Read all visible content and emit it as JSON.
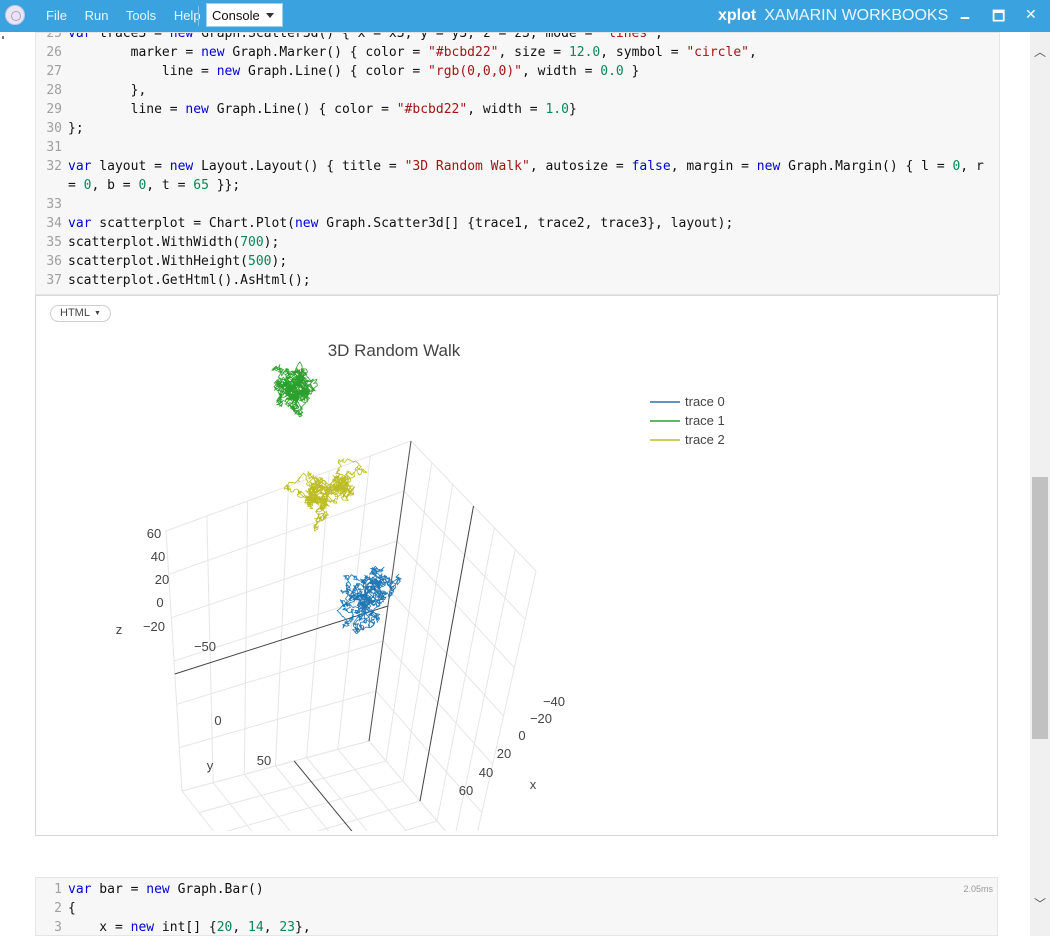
{
  "app": {
    "name": "xplot",
    "window_title": "XAMARIN WORKBOOKS",
    "icon": "workbooks-logo-icon"
  },
  "menu": [
    {
      "label": "File"
    },
    {
      "label": "Run"
    },
    {
      "label": "Tools"
    },
    {
      "label": "Help"
    }
  ],
  "mode_select": {
    "value": "Console"
  },
  "window_controls": {
    "minimize": "🗕",
    "maximize": "🗖",
    "close": "✕"
  },
  "code_cell_1": {
    "lines": [
      {
        "n": "25",
        "tokens": [
          {
            "t": "var",
            "c": "kw"
          },
          {
            "t": " trace3 = "
          },
          {
            "t": "new",
            "c": "kw"
          },
          {
            "t": " Graph.Scatter3d() { x = x3, y = y3, z = z3, mode = "
          },
          {
            "t": "\"lines\"",
            "c": "str"
          },
          {
            "t": ","
          }
        ]
      },
      {
        "n": "26",
        "tokens": [
          {
            "t": "        marker = "
          },
          {
            "t": "new",
            "c": "kw"
          },
          {
            "t": " Graph.Marker() { color = "
          },
          {
            "t": "\"#bcbd22\"",
            "c": "str"
          },
          {
            "t": ", size = "
          },
          {
            "t": "12.0",
            "c": "num"
          },
          {
            "t": ", symbol = "
          },
          {
            "t": "\"circle\"",
            "c": "str"
          },
          {
            "t": ","
          }
        ]
      },
      {
        "n": "27",
        "tokens": [
          {
            "t": "            line = "
          },
          {
            "t": "new",
            "c": "kw"
          },
          {
            "t": " Graph.Line() { color = "
          },
          {
            "t": "\"rgb(0,0,0)\"",
            "c": "str"
          },
          {
            "t": ", width = "
          },
          {
            "t": "0.0",
            "c": "num"
          },
          {
            "t": " }"
          }
        ]
      },
      {
        "n": "28",
        "tokens": [
          {
            "t": "        },"
          }
        ]
      },
      {
        "n": "29",
        "tokens": [
          {
            "t": "        line = "
          },
          {
            "t": "new",
            "c": "kw"
          },
          {
            "t": " Graph.Line() { color = "
          },
          {
            "t": "\"#bcbd22\"",
            "c": "str"
          },
          {
            "t": ", width = "
          },
          {
            "t": "1.0",
            "c": "num"
          },
          {
            "t": "}"
          }
        ]
      },
      {
        "n": "30",
        "tokens": [
          {
            "t": "};"
          }
        ]
      },
      {
        "n": "31",
        "tokens": []
      },
      {
        "n": "32",
        "tokens": [
          {
            "t": "var",
            "c": "kw"
          },
          {
            "t": " layout = "
          },
          {
            "t": "new",
            "c": "kw"
          },
          {
            "t": " Layout.Layout() { title = "
          },
          {
            "t": "\"3D Random Walk\"",
            "c": "str"
          },
          {
            "t": ", autosize = "
          },
          {
            "t": "false",
            "c": "kw"
          },
          {
            "t": ", margin = "
          },
          {
            "t": "new",
            "c": "kw"
          },
          {
            "t": " Graph.Margin() { l = "
          },
          {
            "t": "0",
            "c": "num"
          },
          {
            "t": ", r"
          }
        ]
      },
      {
        "n": "",
        "tokens": [
          {
            "t": "= "
          },
          {
            "t": "0",
            "c": "num"
          },
          {
            "t": ", b = "
          },
          {
            "t": "0",
            "c": "num"
          },
          {
            "t": ", t = "
          },
          {
            "t": "65",
            "c": "num"
          },
          {
            "t": " }};"
          }
        ]
      },
      {
        "n": "33",
        "tokens": []
      },
      {
        "n": "34",
        "tokens": [
          {
            "t": "var",
            "c": "kw"
          },
          {
            "t": " scatterplot = Chart.Plot("
          },
          {
            "t": "new",
            "c": "kw"
          },
          {
            "t": " Graph.Scatter3d[] {trace1, trace2, trace3}, layout);"
          }
        ]
      },
      {
        "n": "35",
        "tokens": [
          {
            "t": "scatterplot.WithWidth("
          },
          {
            "t": "700",
            "c": "num"
          },
          {
            "t": ");"
          }
        ]
      },
      {
        "n": "36",
        "tokens": [
          {
            "t": "scatterplot.WithHeight("
          },
          {
            "t": "500",
            "c": "num"
          },
          {
            "t": ");"
          }
        ]
      },
      {
        "n": "37",
        "tokens": [
          {
            "t": "scatterplot.GetHtml().AsHtml();"
          }
        ]
      }
    ]
  },
  "output_cell": {
    "renderer_label": "HTML"
  },
  "chart_data": {
    "type": "scatter3d",
    "title": "3D Random Walk",
    "mode": "lines",
    "legend_position": "top-right",
    "series": [
      {
        "name": "trace 0",
        "color": "#1f77b4"
      },
      {
        "name": "trace 1",
        "color": "#2ca02c"
      },
      {
        "name": "trace 2",
        "color": "#bcbd22"
      }
    ],
    "axes": {
      "x": {
        "label": "x",
        "ticks": [
          "−40",
          "−20",
          "0",
          "20",
          "40",
          "60"
        ]
      },
      "y": {
        "label": "y",
        "ticks": [
          "−50",
          "0",
          "50"
        ]
      },
      "z": {
        "label": "z",
        "ticks": [
          "−20",
          "0",
          "20",
          "40",
          "60"
        ]
      }
    }
  },
  "code_cell_2": {
    "timing": "2.05ms",
    "lines": [
      {
        "n": "1",
        "tokens": [
          {
            "t": "var",
            "c": "kw"
          },
          {
            "t": " bar = "
          },
          {
            "t": "new",
            "c": "kw"
          },
          {
            "t": " Graph.Bar()"
          }
        ]
      },
      {
        "n": "2",
        "tokens": [
          {
            "t": "{"
          }
        ]
      },
      {
        "n": "3",
        "tokens": [
          {
            "t": "    x = "
          },
          {
            "t": "new",
            "c": "kw"
          },
          {
            "t": " int[] {"
          },
          {
            "t": "20",
            "c": "num"
          },
          {
            "t": ", "
          },
          {
            "t": "14",
            "c": "num"
          },
          {
            "t": ", "
          },
          {
            "t": "23",
            "c": "num"
          },
          {
            "t": "},"
          }
        ]
      }
    ]
  }
}
